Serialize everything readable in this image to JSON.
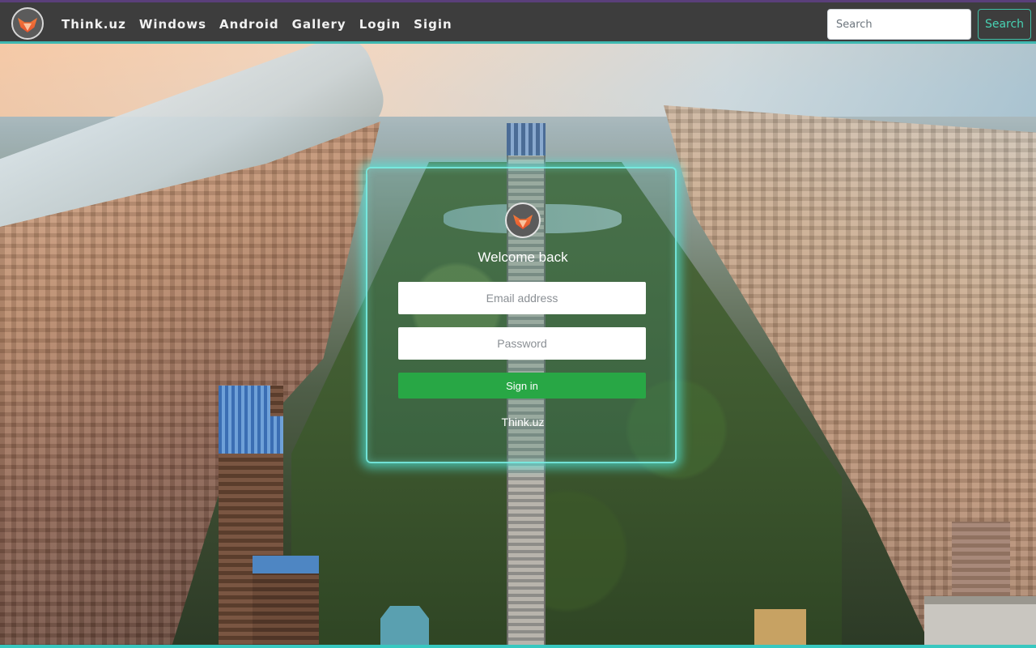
{
  "navbar": {
    "brand_icon": "fox-logo-icon",
    "links": [
      "Think.uz",
      "Windows",
      "Android",
      "Gallery",
      "Login",
      "Sigin"
    ],
    "search": {
      "placeholder": "Search",
      "button_label": "Search"
    },
    "colors": {
      "background": "#3d3d3d",
      "accent": "#3fb8b0"
    }
  },
  "login_card": {
    "logo_icon": "fox-logo-icon",
    "title": "Welcome back",
    "email_placeholder": "Email address",
    "password_placeholder": "Password",
    "signin_label": "Sign in",
    "footer": "Think.uz",
    "colors": {
      "signin_button": "#28a745",
      "glow": "#50e6dc"
    }
  }
}
